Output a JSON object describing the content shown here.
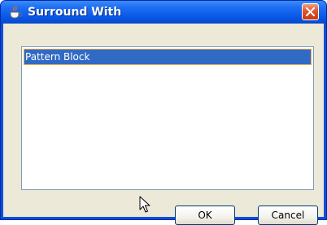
{
  "window": {
    "title": "Surround With",
    "app_icon": "java-cup-icon",
    "close_icon": "close-x-icon"
  },
  "list": {
    "items": [
      {
        "label": "Pattern Block",
        "selected": true
      }
    ]
  },
  "buttons": {
    "ok_label": "OK",
    "cancel_label": "Cancel"
  },
  "colors": {
    "titlebar": "#0a58e8",
    "dialog_bg": "#ece9d8",
    "selection": "#316ac5",
    "close_button": "#e0552b"
  }
}
